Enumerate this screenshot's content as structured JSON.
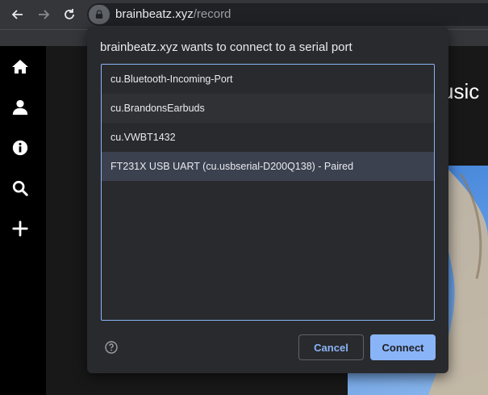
{
  "browser": {
    "url_host": "brainbeatz.xyz",
    "url_path": "/record",
    "back_icon": "back-arrow-icon",
    "forward_icon": "forward-arrow-icon",
    "reload_icon": "reload-icon",
    "lock_icon": "lock-icon"
  },
  "sidebar": {
    "items": [
      {
        "icon": "home-icon"
      },
      {
        "icon": "user-icon"
      },
      {
        "icon": "info-icon"
      },
      {
        "icon": "search-icon"
      },
      {
        "icon": "plus-icon"
      }
    ]
  },
  "page": {
    "heading_fragment": "usic"
  },
  "dialog": {
    "title": "brainbeatz.xyz wants to connect to a serial port",
    "ports": [
      {
        "label": "cu.Bluetooth-Incoming-Port"
      },
      {
        "label": "cu.BrandonsEarbuds"
      },
      {
        "label": "cu.VWBT1432"
      },
      {
        "label": "FT231X USB UART (cu.usbserial-D200Q138) - Paired",
        "selected": true
      }
    ],
    "help_icon": "help-circle-icon",
    "cancel_label": "Cancel",
    "connect_label": "Connect"
  },
  "colors": {
    "accent": "#8ab4f8",
    "dialog_bg": "#292a2d",
    "selected_row": "#3c4150"
  }
}
